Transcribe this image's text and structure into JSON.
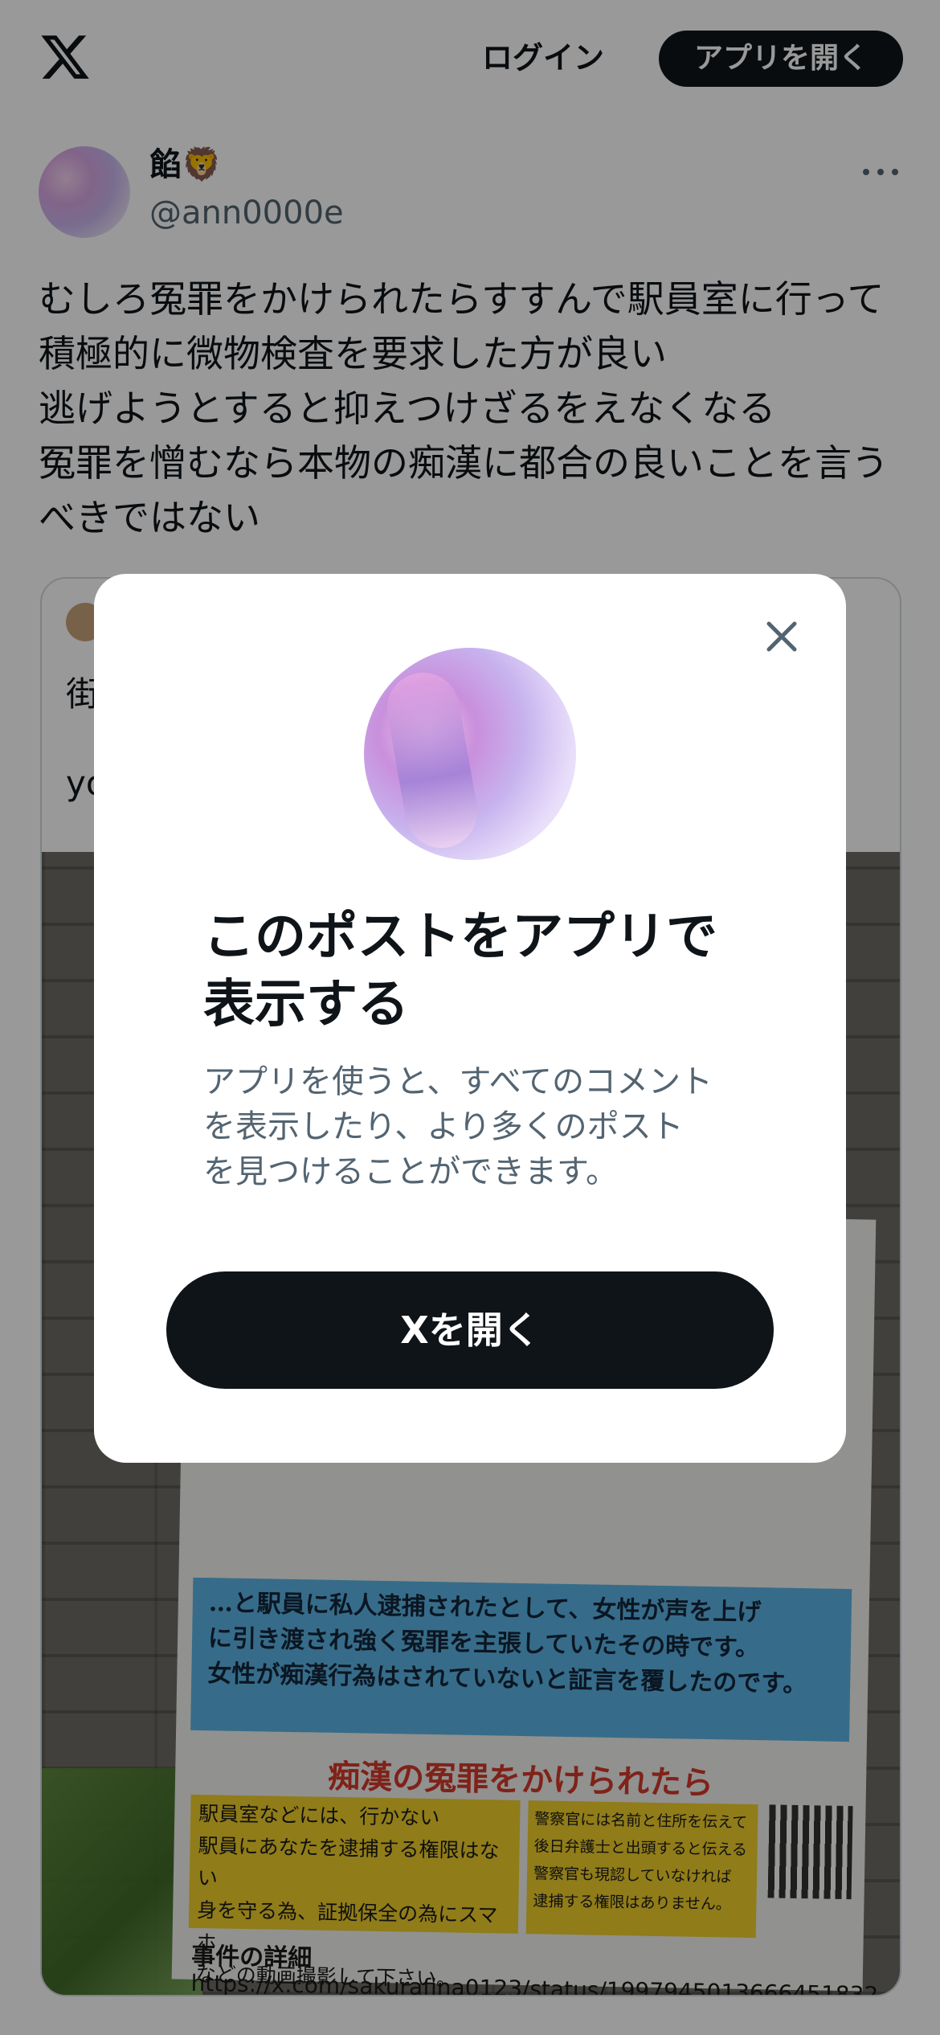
{
  "header": {
    "logo_icon": "x-logo-icon",
    "login_label": "ログイン",
    "open_app_label": "アプリを開く"
  },
  "post": {
    "display_name": "餡",
    "display_name_emoji": "🦁",
    "handle": "@ann0000e",
    "more_icon": "more-horizontal-icon",
    "text": "むしろ冤罪をかけられたらすすんで駅員室に行って積極的に微物検査を要求した方が良い\n逃げようとすると抑えつけざるをえなくなる\n冤罪を憎むなら本物の痴漢に都合の良いことを言うべきではない"
  },
  "quote": {
    "line1": "街",
    "line2": "yo",
    "flyer": {
      "blue_text": "…と駅員に私人逮捕されたとして、女性が声を上げ\nに引き渡され強く冤罪を主張していたその時です。\n女性が痴漢行為はされていないと証言を覆したのです。",
      "heading": "痴漢の冤罪をかけられたら",
      "left_box": "駅員室などには、行かない\n駅員にあなたを逮捕する権限はない\n身を守る為、証拠保全の為にスマホ\nなどの動画撮影して下さい。",
      "right_box": "警察官には名前と住所を伝えて\n後日弁護士と出頭すると伝える\n警察官も現認していなければ\n逮捕する権限はありません。",
      "detail_label": "事件の詳細",
      "url": "https://x.com/sakurafina0123/status/1997945013666451832"
    }
  },
  "modal": {
    "close_icon": "close-icon",
    "title": "このポストをアプリで\n表示する",
    "description": "アプリを使うと、すべてのコメント\nを表示したり、より多くのポスト\nを見つけることができます。",
    "cta_label": "Xを開く"
  },
  "colors": {
    "primary": "#0f1419",
    "secondary_text": "#536471",
    "scrim": "rgba(0,0,0,0.4)"
  }
}
